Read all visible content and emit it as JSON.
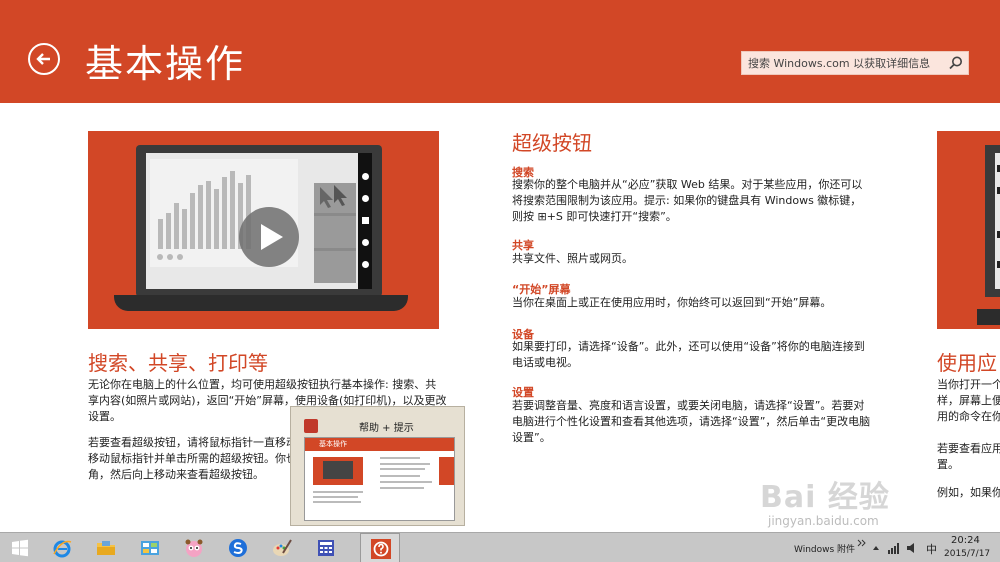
{
  "header": {
    "title": "基本操作",
    "search_placeholder": "搜索 Windows.com 以获取详细信息"
  },
  "left_section": {
    "title": "搜索、共享、打印等",
    "para1": [
      "无论你在电脑上的什么位置，均可使用超级按钮执行基本操作: 搜索、共",
      "享内容(如照片或网站)，返回“开始”屏幕，使用设备(如打印机)，以及更改",
      "设置。"
    ],
    "para2": [
      "若要查看超级按钮，请将鼠标指针一直移动",
      "移动鼠标指针并单击所需的超级按钮。你也",
      "角，然后向上移动来查看超级按钮。"
    ]
  },
  "middle_section": {
    "title": "超级按钮",
    "items": [
      {
        "title": "搜索",
        "lines": [
          "搜索你的整个电脑并从“必应”获取 Web 结果。对于某些应用，你还可以",
          "将搜索范围限制为该应用。提示: 如果你的键盘具有 Windows 徽标键，",
          "则按 ⊞+S 即可快速打开“搜索”。"
        ]
      },
      {
        "title": "共享",
        "lines": [
          "共享文件、照片或网页。"
        ]
      },
      {
        "title": "“开始”屏幕",
        "lines": [
          "当你在桌面上或正在使用应用时，你始终可以返回到“开始”屏幕。"
        ]
      },
      {
        "title": "设备",
        "lines": [
          "如果要打印，请选择“设备”。此外，还可以使用“设备”将你的电脑连接到",
          "电话或电视。"
        ]
      },
      {
        "title": "设置",
        "lines": [
          "若要调整音量、亮度和语言设置，或要关闭电脑，请选择“设置”。若要对",
          "电脑进行个性化设置和查看其他选项，请选择“设置”，然后单击“更改电脑",
          "设置”。"
        ]
      }
    ]
  },
  "right_section": {
    "title": "使用应",
    "lines": [
      "当你打开一个",
      "样，屏幕上便",
      "用的命令在你",
      "",
      "若要查看应用",
      "置。",
      "",
      "例如，如果你"
    ]
  },
  "help_thumbnail": {
    "title": "帮助 + 提示",
    "inner_header": "基本操作"
  },
  "watermark": {
    "text": "Bai 经验",
    "sub": "jingyan.baidu.com"
  },
  "taskbar": {
    "apps": [
      "start",
      "ie-icon",
      "file-explorer-icon",
      "control-panel-icon",
      "qq-pet-icon",
      "sogou-icon",
      "paint-icon",
      "calculator-icon",
      "help-icon"
    ],
    "toolbar_label": "Windows 附件",
    "ime_label": "中",
    "time": "20:24",
    "date": "2015/7/17"
  },
  "colors": {
    "accent": "#d24726",
    "taskbar": "#c7c7c7"
  }
}
